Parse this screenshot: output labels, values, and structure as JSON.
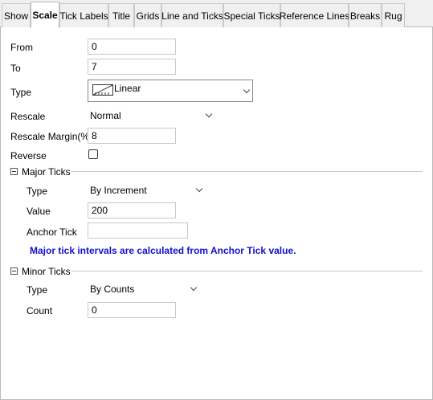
{
  "tabs": [
    {
      "label": "Show"
    },
    {
      "label": "Scale"
    },
    {
      "label": "Tick Labels"
    },
    {
      "label": "Title"
    },
    {
      "label": "Grids"
    },
    {
      "label": "Line and Ticks"
    },
    {
      "label": "Special Ticks"
    },
    {
      "label": "Reference Lines"
    },
    {
      "label": "Breaks"
    },
    {
      "label": "Rug"
    }
  ],
  "active_tab": "Scale",
  "scale": {
    "from_label": "From",
    "from_value": "0",
    "to_label": "To",
    "to_value": "7",
    "type_label": "Type",
    "type_value": "Linear",
    "type_icon": "linear-scale-icon",
    "rescale_label": "Rescale",
    "rescale_value": "Normal",
    "rescale_margin_label": "Rescale Margin(%)",
    "rescale_margin_value": "8",
    "reverse_label": "Reverse",
    "reverse_checked": false
  },
  "major_ticks": {
    "group_label": "Major Ticks",
    "type_label": "Type",
    "type_value": "By Increment",
    "value_label": "Value",
    "value_value": "200",
    "anchor_label": "Anchor Tick",
    "anchor_value": "",
    "info_text": "Major tick intervals are calculated from Anchor Tick value."
  },
  "minor_ticks": {
    "group_label": "Minor Ticks",
    "type_label": "Type",
    "type_value": "By Counts",
    "count_label": "Count",
    "count_value": "0"
  },
  "colors": {
    "info_text": "#1010c8",
    "tab_bg": "#f0f0f0",
    "panel_bg": "#ffffff"
  }
}
